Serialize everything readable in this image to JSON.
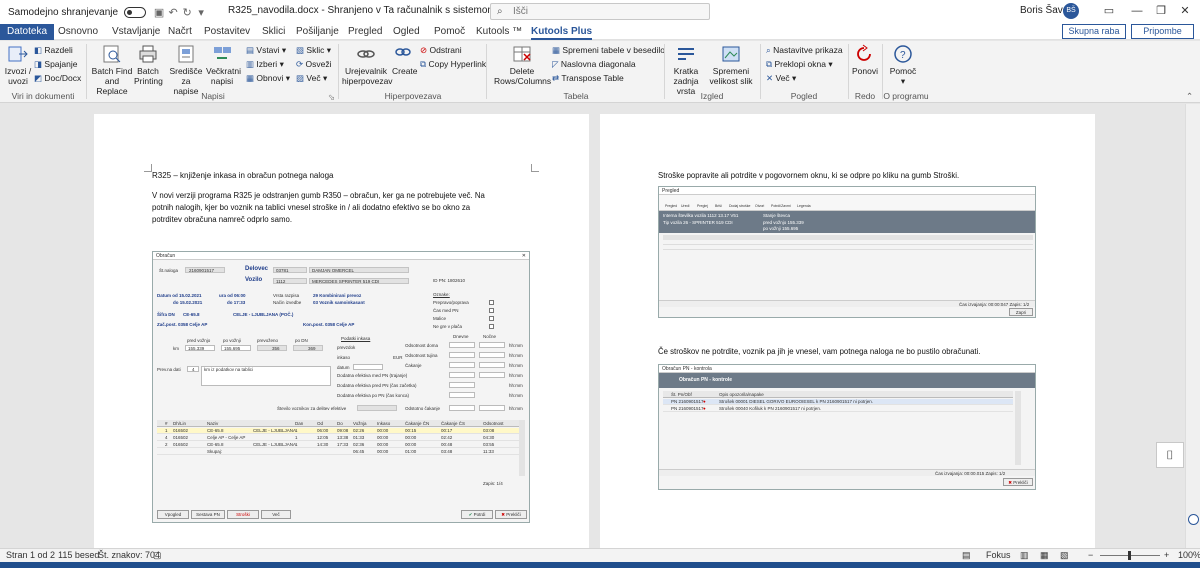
{
  "titlebar": {
    "autosave_label": "Samodejno shranjevanje",
    "doc_title": "R325_navodila.docx  -  Shranjeno v Ta računalnik s sistemom Windows  ▾",
    "search_placeholder": "Išči",
    "user_name": "Boris Šavc",
    "user_initials": "BŠ",
    "minimize": "—",
    "restore": "❐",
    "close": "✕"
  },
  "tabs": [
    "Datoteka",
    "Osnovno",
    "Vstavljanje",
    "Načrt",
    "Postavitev",
    "Sklici",
    "Pošiljanje",
    "Pregled",
    "Ogled",
    "Pomoč",
    "Kutools ™",
    "Kutools Plus"
  ],
  "share_label": "Skupna raba",
  "comment_label": "Pripombe",
  "ribbon": {
    "g1": {
      "izvozi": "Izvozi / uvozi",
      "razdeli": "Razdeli",
      "spajanje": "Spajanje",
      "docdocx": "Doc/Docx",
      "label": "Viri in dokumenti"
    },
    "g2": {
      "batch_find": "Batch Find and Replace",
      "batch_print": "Batch Printing",
      "sredisce": "Središče za napise",
      "veckratni": "Večkratni napisi",
      "vstavi": "Vstavi",
      "izberi": "Izberi",
      "obnovi": "Obnovi",
      "sklic": "Sklic",
      "osvezi": "Osveži",
      "vec": "Več",
      "label": "Napisi"
    },
    "g3": {
      "urejevalnik": "Urejevalnik hiperpovezav",
      "create": "Create",
      "odstrani": "Odstrani",
      "copy_hyperlink": "Copy Hyperlink",
      "label": "Hiperpovezava"
    },
    "g4": {
      "delete": "Delete Rows/Columns",
      "spremeni": "Spremeni tabele v besedilo",
      "naslovna": "Naslovna diagonala",
      "transpose": "Transpose Table",
      "label": "Tabela"
    },
    "g5": {
      "kratka": "Kratka zadnja vrsta",
      "spremeni_vel": "Spremeni velikost slik",
      "label": "Izgled"
    },
    "g6": {
      "nastavitve": "Nastavitve prikaza",
      "preklopi": "Preklopi okna",
      "vec": "Več",
      "label": "Pogled"
    },
    "g7": {
      "ponovi": "Ponovi",
      "label": "Redo"
    },
    "g8": {
      "pomoc": "Pomoč",
      "label": "O programu"
    }
  },
  "left_page": {
    "heading": "R325 – knjiženje inkasa in obračun potnega naloga",
    "para1": "V novi verziji programa R325 je odstranjen gumb R350 – obračun, ker ga ne potrebujete več. Na",
    "para2": "potnih nalogih, kjer bo voznik na tablici vnesel stroške in / ali dodatno efektivo se bo okno za",
    "para3": "potrditev obračuna namreč odprlo samo."
  },
  "right_page": {
    "text1": "Stroške popravite ali potrdite v pogovornem oknu, ki se odpre po kliku na gumb Stroški.",
    "text2": "Če stroškov  ne potrdite, voznik pa jih je vnesel, vam potnega naloga ne bo pustilo obračunati."
  },
  "dialog_obracun": {
    "title": "Obračun",
    "st_naloga_label": "Št.naloga",
    "st_naloga": "2160901517",
    "delovec_label": "Delovec",
    "delovec_code": "03781",
    "delovec_name": "DAMJAN OMERCEL",
    "vozilo_label": "Vozilo",
    "vozilo_code": "1112",
    "vozilo_name": "MERCEDES SPRINTER 519 CDI",
    "id_pn": "ID PN:  1802610",
    "datum_od": "Datum od  15.02.2021",
    "ura_od": "ura od  06:00",
    "vrsta_razpisa": "Vrsta razpisa",
    "vrsta_val": "29 Kombinirani prevoz",
    "datum_do": "do  15.02.2021",
    "ura_do": "do  17:33",
    "nacin_izvedbe": "Način izvedbe",
    "nacin_val": "03 Voznik samoinkasant",
    "sifra_dn": "Šifra DN",
    "sifra_val": "CE-65.8",
    "sifra_desc": "CELJE - LJUBLJANA (POČ.)",
    "zac_post": "Zač.post.  0358 Celje AP",
    "kon_post": "Kon.post.  0358 Celje AP",
    "oznake_title": "Oznake:",
    "oznake": [
      "Prepravo/poprava",
      "Čas med PN",
      "Malice",
      "Ne gre v plača"
    ],
    "pred_vozinjo": "pred vožnjo",
    "po_voznji": "po vožnji",
    "prevozeno": "prevoženo",
    "po_dn": "po DN",
    "km_label": "km",
    "km_vals": [
      "155.339",
      "155.695",
      "356",
      "369"
    ],
    "podatki_inkasa": "Podatki inkasa",
    "prevzdok": "prevzdok",
    "inkaso": "inkaso",
    "datum": "datum",
    "eur": "EUR",
    "odsotnost_doma": "Odsotnost doma",
    "odsotnost_tujina": "Odsotnost tujina",
    "cakanje": "Čakanje",
    "dodatna1": "Dodatna efektiva med PN (trajanje)",
    "dodatna2": "Dodatna efektiva pred PN (čas začetka)",
    "dodatna3": "Dodatna efektiva po PN (čas konca)",
    "dnevne": "Dnevne",
    "nocne": "Nočne",
    "hmm": "hh:mm",
    "prev_dati": "Prev.na dati",
    "prev_num": "4",
    "prev_note": "km iz podatkov na tablici",
    "stevilo": "Število voznikov za delitev efektive",
    "odstotno_cakanje": "Odstotno čakanje",
    "table_headers": [
      "#",
      "Dh/Lin",
      "Naziv",
      "",
      "Dan",
      "Od",
      "Do",
      "Vožnja",
      "Inkaso",
      "Čakanje ČN",
      "Čakanje ČS",
      "Odsotnost"
    ],
    "rows": [
      [
        "1",
        "016502",
        "CE-65.8",
        "CELJE - LJUBLJANA",
        "1",
        "06:00",
        "09:08",
        "02:26",
        "00:00",
        "00:15",
        "00:17",
        "03:08"
      ],
      [
        "4",
        "016502",
        "Celje AP - Celje AP",
        "",
        "1",
        "12:05",
        "13:38",
        "01:33",
        "00:00",
        "00:00",
        "02:42",
        "04:30"
      ],
      [
        "2",
        "016502",
        "CE-65.8",
        "CELJE - LJUBLJANA",
        "1",
        "14:30",
        "17:33",
        "02:36",
        "00:00",
        "00:00",
        "00:48",
        "03:55"
      ],
      [
        "",
        "",
        "Skupaj:",
        "",
        "",
        "",
        "",
        "06:45",
        "00:00",
        "01:00",
        "03:48",
        "11:33"
      ]
    ],
    "zapis": "Zapis:  1/4",
    "buttons": [
      "Vpogled",
      "Sestava PN",
      "Stroški",
      "Več",
      "Potrdi",
      "Prekliči"
    ]
  },
  "dialog_stroski": {
    "title": "Pregled",
    "tool": [
      "Pregled",
      "Uredi",
      "Preglej",
      "Briši",
      "Dodaj stroške",
      "Otvori",
      "Potrdi/Zavrni",
      "Legenda"
    ],
    "info1": "Interna številka vozila  1112  13.17 V51",
    "info2": "Tip vozila  26 - SPRINTER 519 CDI",
    "info3": "Stanje števca",
    "info4": "pred vožnjo  155.339",
    "info5": "po vožnji  155.695",
    "status": "Čas izvajanja: 00:00:047   Zapis: 1/2",
    "btn": "Zapri"
  },
  "dialog_kontrola": {
    "title": "Obračun PN - kontrola",
    "header": "Obračun PN - kontrole",
    "col1": "Št. Pn/Obf",
    "col2": "Opis opozorila/napake",
    "rows": [
      [
        "PN  2160901517",
        "Strošek 00001 DIESEL GORIVO EUROOIESEL k PN 2160901517 ni potrjen."
      ],
      [
        "PN  2160901517",
        "Strošek 00040 Kofiluk k PN 2160901517 ni potrjen."
      ]
    ],
    "status": "Čas izvajanja: 00:00.015   Zapis: 1/2",
    "btn": "Prekliči"
  },
  "statusbar": {
    "page": "Stran 1 od 2",
    "words": "115 besed",
    "chars": "Št. znakov: 704",
    "focus": "Fokus",
    "zoom": "100%"
  }
}
